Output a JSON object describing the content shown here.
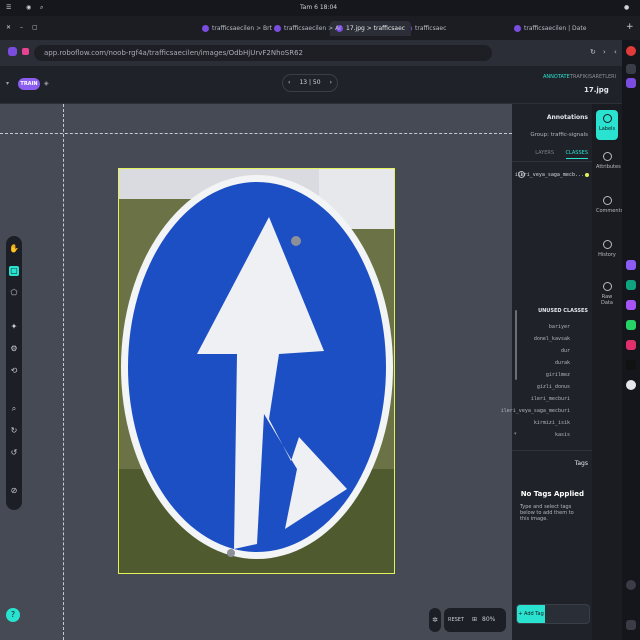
{
  "os": {
    "clock": "Tam 6 18:04"
  },
  "browser": {
    "tabs": [
      "trafficsaecilen | Date",
      "trafficsaecilen > Brt",
      "trafficsaecilen > Ar",
      "17.jpg > trafficsaec",
      "trafficsaec"
    ],
    "url": "app.roboflow.com/noob-rgf4a/trafficsaecilen/images/OdbHjUrvF2NhoSR62"
  },
  "header": {
    "crumb": "TRAFIKISARETLERI",
    "annotate": "ANNOTATE",
    "filename": "17.jpg",
    "counter": "13 | 50",
    "train_label": "TRAIN"
  },
  "canvas_footer": {
    "reset": "RESET",
    "zoom": "80%"
  },
  "panel": {
    "heading": "Annotations",
    "group": "Group: traffic-signals",
    "tab_classes": "CLASSES",
    "tab_layers": "LAYERS",
    "used_class": "ileri_veya_saga_mecb...",
    "used_count": "1",
    "unused_heading": "UNUSED CLASSES",
    "unused": [
      "bariyer",
      "donel_kavsak",
      "dur",
      "durak",
      "girilmez",
      "gizli_donus",
      "ileri_mecburi",
      "ileri_veya_saga_mecburi",
      "kirmizi_isik",
      "kasis"
    ],
    "tags_heading": "Tags",
    "no_tags_title": "No Tags Applied",
    "no_tags_body": "Type and select tags below to add them to this image.",
    "add_tag_placeholder": "+ Add Tag"
  },
  "rail": [
    "Labels",
    "Attributes",
    "Comments",
    "History",
    "Raw Data"
  ],
  "colors": {
    "accent": "#29e3d0",
    "bbox": "#e3f25a",
    "sign_blue": "#1d4fc4",
    "brand": "#7a4ce0"
  }
}
